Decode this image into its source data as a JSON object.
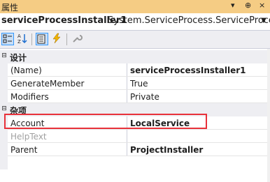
{
  "window": {
    "title": "属性",
    "pin_glyph": "▾",
    "pin2_glyph": "⊕",
    "close_glyph": "×"
  },
  "object": {
    "name": "serviceProcessInstaller1",
    "type": "System.ServiceProcess.ServiceProces"
  },
  "toolbar": {
    "categorized_icon": "categorized-icon",
    "alphabetical_icon": "alphabetical-icon",
    "properties_icon": "properties-icon",
    "events_icon": "events-icon",
    "property_pages_icon": "wrench-icon"
  },
  "categories": [
    {
      "label": "设计",
      "toggle": "⊟",
      "rows": [
        {
          "name": "(Name)",
          "value": "serviceProcessInstaller1",
          "bold": true,
          "dim": false
        },
        {
          "name": "GenerateMember",
          "value": "True",
          "bold": false,
          "dim": false
        },
        {
          "name": "Modifiers",
          "value": "Private",
          "bold": false,
          "dim": false
        }
      ]
    },
    {
      "label": "杂项",
      "toggle": "⊟",
      "rows": [
        {
          "name": "Account",
          "value": "LocalService",
          "bold": true,
          "dim": false
        },
        {
          "name": "HelpText",
          "value": "",
          "bold": false,
          "dim": true
        },
        {
          "name": "Parent",
          "value": "ProjectInstaller",
          "bold": true,
          "dim": false
        }
      ]
    }
  ],
  "colors": {
    "title_bg": "#f5cc84",
    "highlight_border": "#e8313a"
  }
}
